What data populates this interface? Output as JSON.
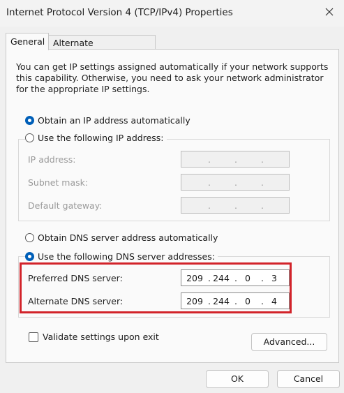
{
  "window": {
    "title": "Internet Protocol Version 4 (TCP/IPv4) Properties"
  },
  "tabs": [
    {
      "label": "General",
      "selected": true
    },
    {
      "label": "Alternate Configuration",
      "selected": false
    }
  ],
  "intro": "You can get IP settings assigned automatically if your network supports this capability. Otherwise, you need to ask your network administrator for the appropriate IP settings.",
  "ip_mode": {
    "auto_label": "Obtain an IP address automatically",
    "manual_label": "Use the following IP address:",
    "selected": "auto"
  },
  "ip_fields": {
    "ip_address": {
      "label": "IP address:",
      "octets": [
        "",
        "",
        "",
        ""
      ]
    },
    "subnet_mask": {
      "label": "Subnet mask:",
      "octets": [
        "",
        "",
        "",
        ""
      ]
    },
    "default_gateway": {
      "label": "Default gateway:",
      "octets": [
        "",
        "",
        "",
        ""
      ]
    }
  },
  "dns_mode": {
    "auto_label": "Obtain DNS server address automatically",
    "manual_label": "Use the following DNS server addresses:",
    "selected": "manual"
  },
  "dns_fields": {
    "preferred": {
      "label": "Preferred DNS server:",
      "octets": [
        "209",
        "244",
        "0",
        "3"
      ]
    },
    "alternate": {
      "label": "Alternate DNS server:",
      "octets": [
        "209",
        "244",
        "0",
        "4"
      ]
    }
  },
  "validate": {
    "label": "Validate settings upon exit",
    "checked": false
  },
  "buttons": {
    "advanced": "Advanced...",
    "ok": "OK",
    "cancel": "Cancel"
  },
  "accent_color": "#005fb8",
  "highlight_color": "#d2232a"
}
